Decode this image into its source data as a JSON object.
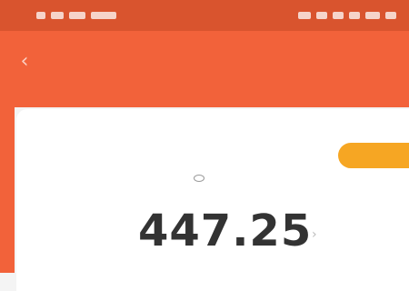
{
  "status_bar": {
    "left_text": "",
    "right_text": ""
  },
  "header": {
    "back_icon": "chevron-left-icon",
    "title": "",
    "subtitle": ""
  },
  "card": {
    "badge_text": "",
    "balance_label": "",
    "balance_value": "447.25",
    "eye_icon": "eye-icon",
    "chevron_icon": "chevron-right-icon"
  },
  "colors": {
    "status_bar": "#d9542e",
    "header": "#f2623a",
    "badge": "#f6a623",
    "card": "#ffffff",
    "value_text": "#333333"
  }
}
